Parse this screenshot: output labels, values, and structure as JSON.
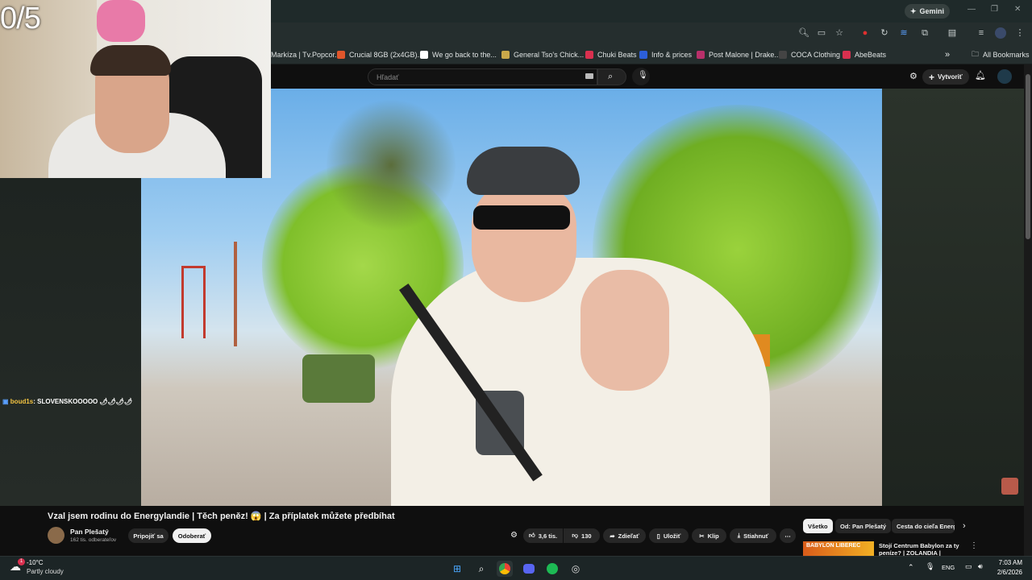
{
  "browser": {
    "gemini_label": "Gemini",
    "bookmarks": [
      {
        "label": "Markíza | Tv.Popcor...",
        "color": "#2a2a2a"
      },
      {
        "label": "Crucial 8GB (2x4GB)...",
        "color": "#e0562b"
      },
      {
        "label": "We go back to the...",
        "color": "#ffffff"
      },
      {
        "label": "General Tso's Chick...",
        "color": "#c9a84a"
      },
      {
        "label": "Chuki Beats",
        "color": "#d9304f"
      },
      {
        "label": "Info & prices",
        "color": "#2c5fd9"
      },
      {
        "label": "Post Malone | Drake...",
        "color": "#b8306a"
      },
      {
        "label": "COCA Clothing",
        "color": "#222222"
      },
      {
        "label": "AbeBeats",
        "color": "#d9304f"
      }
    ],
    "more_label": "»",
    "all_bookmarks": "All Bookmarks"
  },
  "youtube": {
    "search_placeholder": "Hľadať",
    "create_label": "Vytvoriť",
    "video_title": "Vzal jsem rodinu do Energylandie | Těch peněz! 😱 | Za příplatek můžete předbíhat",
    "channel_name": "Pan Plešatý",
    "subscribers": "162 tis. odberateľov",
    "join_label": "Pripojiť sa",
    "unsubscribe_label": "Odoberať",
    "likes": "3,6 tis.",
    "dislikes": "130",
    "share_label": "Zdieľať",
    "save_label": "Uložiť",
    "clip_label": "Klip",
    "download_label": "Stiahnuť",
    "chips": [
      "Všetko",
      "Od: Pan Plešatý",
      "Cesta do cieľa Energ"
    ],
    "recommended_title": "Stojí Centrum Babylon za ty peníze? | ZOLANDIA | Anunex",
    "recommended_thumb_text": "BABYLON LIBEREC"
  },
  "overlay": {
    "score": "0/5",
    "chat_user": "boud1s",
    "chat_text": ": SLOVENSKOOOOO 🌶🌶🌶🌶"
  },
  "taskbar": {
    "weather_temp": "-10°C",
    "weather_desc": "Partly cloudy",
    "weather_badge": "1",
    "lang": "ENG",
    "time": "7:03 AM",
    "date": "2/6/2026"
  },
  "colors": {
    "accent_red": "#ff0033",
    "chrome_bg": "#252e2e",
    "yt_bg": "#0f0f0f"
  }
}
